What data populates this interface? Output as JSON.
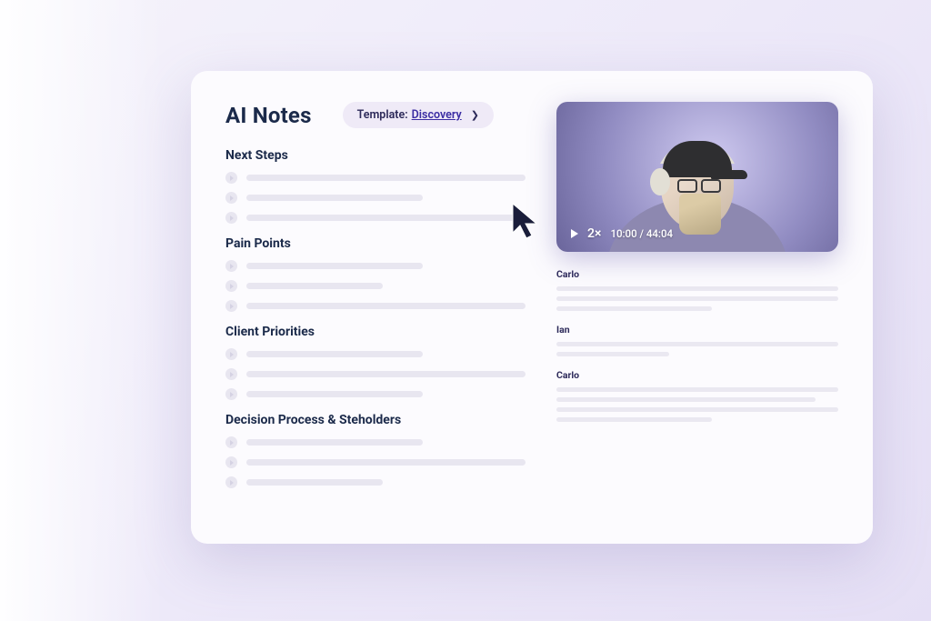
{
  "header": {
    "title": "AI Notes",
    "template_label": "Template: ",
    "template_value": "Discovery"
  },
  "sections": [
    {
      "heading": "Next Steps"
    },
    {
      "heading": "Pain Points"
    },
    {
      "heading": "Client Priorities"
    },
    {
      "heading": "Decision Process & Steholders"
    }
  ],
  "video": {
    "speed": "2×",
    "current_time": "10:00",
    "separator": "/",
    "total_time": "44:04"
  },
  "transcript": [
    {
      "speaker": "Carlo"
    },
    {
      "speaker": "Ian"
    },
    {
      "speaker": "Carlo"
    }
  ]
}
